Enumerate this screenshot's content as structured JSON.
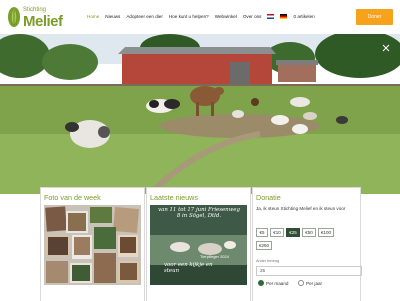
{
  "header": {
    "logo_small": "Stichting",
    "logo_big": "Melief",
    "nav": [
      "Home",
      "Nieuws",
      "Adopteer een dier",
      "Hoe kunt u helpen?",
      "Webwinkel",
      "Over ons"
    ],
    "cart": "0 artikelen",
    "donate_button": "Doner"
  },
  "hero": {
    "alt": "farm animals in the pasture"
  },
  "photo_week": {
    "title": "Foto van de week"
  },
  "news": {
    "title": "Laatste nieuws",
    "image_text_top": "van 11 tot 17 juni Friesenweg 8 in Sögel, Dtld.",
    "image_text_mid": "Tierpfleger 2024",
    "image_text_bottom": "voor een kijkje en steun"
  },
  "donation": {
    "title": "Donatie",
    "intro": "Ja, ik steun Stichting Melief en ik steun voor",
    "amounts": [
      "€5",
      "€10",
      "€25",
      "€50",
      "€100",
      "€250"
    ],
    "selected": "€25",
    "other_label": "Ander bedrag",
    "other_value": "25",
    "freq_monthly": "Per maand",
    "freq_yearly": "Per jaar"
  },
  "colors": {
    "brand_green": "#7a9e2a",
    "donate_orange": "#f7a21b",
    "selected_amount": "#2f4e35"
  }
}
